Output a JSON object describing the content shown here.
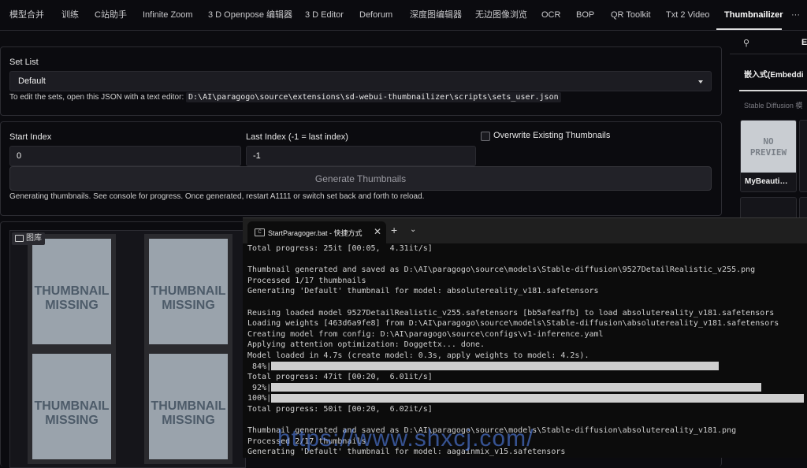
{
  "tabs": [
    "模型合并",
    "训练",
    "C站助手",
    "Infinite Zoom",
    "3 D Openpose 编辑器",
    "3 D Editor",
    "Deforum",
    "深度图编辑器",
    "无边图像浏览",
    "OCR",
    "BOP",
    "QR Toolkit",
    "Txt 2 Video",
    "Thumbnailizer",
    "···"
  ],
  "set_list": {
    "label": "Set List",
    "value": "Default",
    "hint_prefix": "To edit the sets, open this JSON with a text editor:",
    "hint_path": "D:\\AI\\paragogo\\source\\extensions\\sd-webui-thumbnailizer\\scripts\\sets_user.json"
  },
  "index": {
    "start_label": "Start Index",
    "start_value": "0",
    "last_label": "Last Index (-1 = last index)",
    "last_value": "-1",
    "overwrite_label": "Overwrite Existing Thumbnails"
  },
  "generate": {
    "button": "Generate Thumbnails",
    "status": "Generating thumbnails. See console for progress. Once generated, restart A1111 or switch set back and forth to reload."
  },
  "gallery": {
    "label": "图库",
    "thumb_line1": "THUMBNAIL",
    "thumb_line2": "MISSING"
  },
  "right_panel": {
    "tab_label": "嵌入式(Embeddi",
    "search_placeholder": "Stable Diffusion 模",
    "card_title": "MyBeauti…",
    "no_preview_line1": "NO",
    "no_preview_line2": "PREVIEW",
    "head_letter": "E"
  },
  "terminal": {
    "tab_title": "StartParagoger.bat - 快捷方式",
    "lines": [
      "Total progress: 25it [00:05,  4.31it/s]",
      "",
      "Thumbnail generated and saved as D:\\AI\\paragogo\\source\\models\\Stable-diffusion\\9527DetailRealistic_v255.png",
      "Processed 1/17 thumbnails",
      "Generating 'Default' thumbnail for model: absolutereality_v181.safetensors",
      "",
      "Reusing loaded model 9527DetailRealistic_v255.safetensors [bb5afeaffb] to load absolutereality_v181.safetensors",
      "Loading weights [463d6a9fe8] from D:\\AI\\paragogo\\source\\models\\Stable-diffusion\\absolutereality_v181.safetensors",
      "Creating model from config: D:\\AI\\paragogo\\source\\configs\\v1-inference.yaml",
      "Applying attention optimization: Doggettx... done.",
      "Model loaded in 4.7s (create model: 0.3s, apply weights to model: 4.2s).",
      "P84",
      "Total progress: 47it [00:20,  6.01it/s]",
      "P92",
      "P100",
      "Total progress: 50it [00:20,  6.02it/s]",
      "",
      "Thumbnail generated and saved as D:\\AI\\paragogo\\source\\models\\Stable-diffusion\\absolutereality_v181.png",
      "Processed 2/17 thumbnails",
      "Generating 'Default' thumbnail for model: aagainmix_v15.safetensors"
    ],
    "progress": [
      {
        "label": " 84%|",
        "fraction": 0.84
      },
      {
        "label": " 92%|",
        "fraction": 0.92
      },
      {
        "label": "100%|",
        "fraction": 1.0
      }
    ]
  },
  "watermark": "https://www.shxcj.com/"
}
